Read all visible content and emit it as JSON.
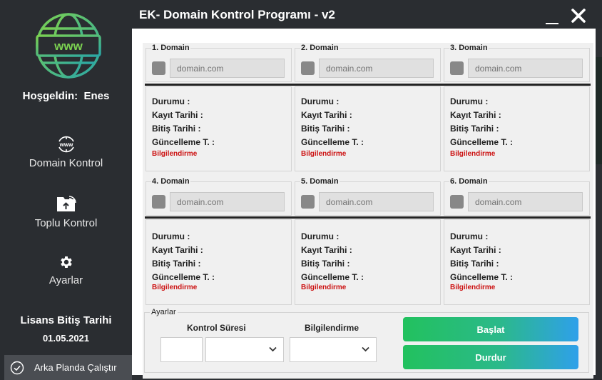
{
  "window": {
    "title": "EK- Domain Kontrol Programı - v2"
  },
  "sidebar": {
    "welcome_prefix": "Hoşgeldin:",
    "user_name": "Enes",
    "logo_text": "www",
    "nav": [
      {
        "label": "Domain Kontrol",
        "icon": "globe-www-icon"
      },
      {
        "label": "Toplu Kontrol",
        "icon": "folder-upload-icon"
      },
      {
        "label": "Ayarlar",
        "icon": "gear-icon"
      }
    ],
    "license_title": "Lisans Bitiş Tarihi",
    "license_date": "01.05.2021",
    "background_run_label": "Arka Planda Çalıştır"
  },
  "domains": [
    {
      "title": "1. Domain",
      "placeholder": "domain.com"
    },
    {
      "title": "2. Domain",
      "placeholder": "domain.com"
    },
    {
      "title": "3. Domain",
      "placeholder": "domain.com"
    },
    {
      "title": "4. Domain",
      "placeholder": "domain.com"
    },
    {
      "title": "5. Domain",
      "placeholder": "domain.com"
    },
    {
      "title": "6. Domain",
      "placeholder": "domain.com"
    }
  ],
  "info_labels": {
    "status": "Durumu :",
    "registered": "Kayıt Tarihi :",
    "expiry": "Bitiş Tarihi :",
    "updated": "Güncelleme T. :",
    "notify": "Bilgilendirme"
  },
  "settings": {
    "group_title": "Ayarlar",
    "interval_label": "Kontrol Süresi",
    "notify_label": "Bilgilendirme",
    "start_label": "Başlat",
    "stop_label": "Durdur"
  },
  "colors": {
    "sidebar_bg": "#2a2d31",
    "notify_red": "#cc1111",
    "button_green": "#22c15e",
    "button_blue": "#2fa0ea",
    "logo_gradient_start": "#7bd151",
    "logo_gradient_end": "#2aa6a6"
  }
}
